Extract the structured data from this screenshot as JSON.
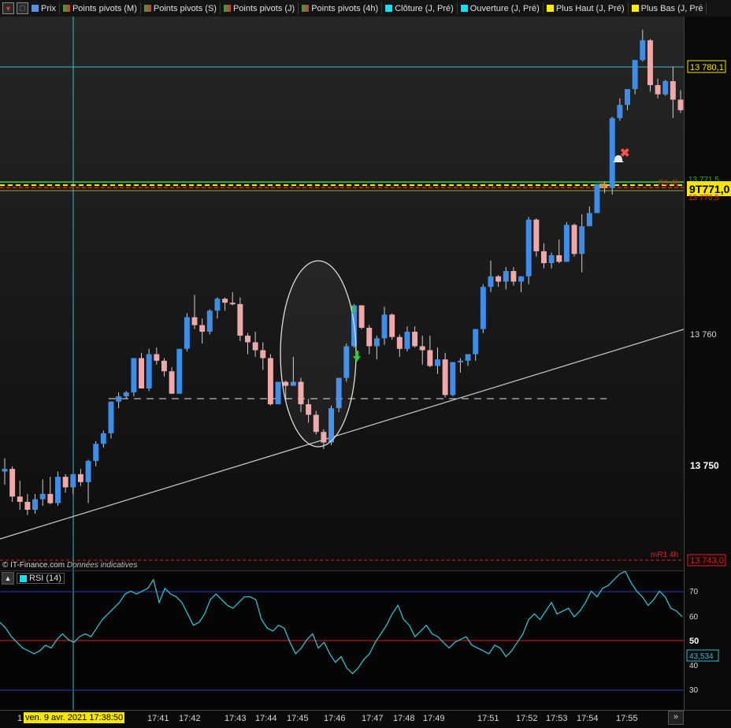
{
  "toolbar": {
    "items": [
      {
        "label": "Prix",
        "color": "#5c8ee6"
      },
      {
        "label": "Points pivots (M)",
        "color": "#2fa83a"
      },
      {
        "label": "Points pivots (S)",
        "color": "#2fa83a"
      },
      {
        "label": "Points pivots (J)",
        "color": "#2fa83a"
      },
      {
        "label": "Points pivots (4h)",
        "color": "#2fa83a"
      },
      {
        "label": "Clôture (J, Pré)",
        "color": "#00e5ff"
      },
      {
        "label": "Ouverture (J, Pré)",
        "color": "#00e5ff"
      },
      {
        "label": "Plus Haut (J, Pré)",
        "color": "#ffee00"
      },
      {
        "label": "Plus Bas (J, Pré",
        "color": "#ffee00"
      }
    ]
  },
  "watermark": {
    "source": "© IT-Finance.com",
    "note": "Données indicatives"
  },
  "rsi_title": "RSI (14)",
  "date_label": "ven. 9 avr. 2021 17:38:50",
  "x_first_char": "1",
  "scroll_glyph": "»",
  "price_labels": {
    "p1": "13 780,1",
    "p2": "13 771,5",
    "p3": "9T771,0",
    "p4": "13 770,5",
    "p5": "13 760",
    "p6": "13 750",
    "p7": "13 743,0",
    "r1": "R1 4h",
    "mr1": "mR1 4h"
  },
  "rsi_labels": {
    "t70": "70",
    "t60": "60",
    "t50": "50",
    "t40": "40",
    "t30": "30",
    "current": "43,534"
  },
  "x_labels": [
    "17:41",
    "17:42",
    "17:43",
    "17:44",
    "17:45",
    "17:46",
    "17:47",
    "17:48",
    "17:49",
    "17:51",
    "17:52",
    "17:53",
    "17:54",
    "17:55"
  ],
  "colors": {
    "up": "#3d8eea",
    "down": "#f0a8a8",
    "rsi": "#2fbfcf",
    "ref_line": "#3bbccc"
  },
  "chart_data": {
    "type": "candlestick",
    "ylim": [
      13742,
      13784
    ],
    "ohlc": [
      [
        13749.5,
        13750.5,
        13748.5,
        13749.7
      ],
      [
        13749.7,
        13749.9,
        13747.2,
        13747.6
      ],
      [
        13747.6,
        13748.8,
        13746.6,
        13747.2
      ],
      [
        13747.2,
        13747.8,
        13746.2,
        13746.6
      ],
      [
        13746.6,
        13747.8,
        13746.3,
        13747.4
      ],
      [
        13747.4,
        13748.9,
        13746.9,
        13747.8
      ],
      [
        13747.8,
        13749.1,
        13747.0,
        13747.1
      ],
      [
        13747.1,
        13749.5,
        13746.9,
        13749.1
      ],
      [
        13749.1,
        13749.3,
        13747.9,
        13748.3
      ],
      [
        13748.3,
        13749.3,
        13747.8,
        13749.3
      ],
      [
        13749.3,
        13749.7,
        13748.4,
        13748.7
      ],
      [
        13748.7,
        13750.4,
        13747.1,
        13750.3
      ],
      [
        13750.3,
        13751.8,
        13749.9,
        13751.6
      ],
      [
        13751.6,
        13752.6,
        13751.3,
        13752.4
      ],
      [
        13752.4,
        13754.8,
        13752.0,
        13754.8
      ],
      [
        13754.8,
        13755.5,
        13754.3,
        13755.2
      ],
      [
        13755.2,
        13755.6,
        13755.0,
        13755.5
      ],
      [
        13755.5,
        13758.1,
        13755.2,
        13758.1
      ],
      [
        13758.1,
        13758.5,
        13755.8,
        13755.8
      ],
      [
        13755.8,
        13758.8,
        13755.6,
        13758.4
      ],
      [
        13758.4,
        13758.9,
        13757.6,
        13757.9
      ],
      [
        13757.9,
        13758.1,
        13756.7,
        13757.1
      ],
      [
        13757.1,
        13757.4,
        13755.4,
        13755.4
      ],
      [
        13755.4,
        13758.8,
        13755.4,
        13758.8
      ],
      [
        13758.8,
        13761.5,
        13758.6,
        13761.2
      ],
      [
        13761.2,
        13762.9,
        13760.3,
        13760.6
      ],
      [
        13760.6,
        13761.1,
        13759.2,
        13760.1
      ],
      [
        13760.1,
        13761.8,
        13759.9,
        13761.7
      ],
      [
        13761.7,
        13762.7,
        13761.1,
        13762.6
      ],
      [
        13762.6,
        13762.7,
        13761.7,
        13762.3
      ],
      [
        13762.3,
        13763.1,
        13762.1,
        13762.2
      ],
      [
        13762.2,
        13762.7,
        13759.4,
        13759.8
      ],
      [
        13759.8,
        13760.0,
        13758.4,
        13759.3
      ],
      [
        13759.3,
        13760.1,
        13758.2,
        13758.7
      ],
      [
        13758.7,
        13759.3,
        13757.2,
        13758.1
      ],
      [
        13758.1,
        13758.4,
        13754.5,
        13754.6
      ],
      [
        13754.6,
        13756.3,
        13754.6,
        13756.3
      ],
      [
        13756.3,
        13756.4,
        13754.9,
        13756.0
      ],
      [
        13756.0,
        13758.2,
        13756.1,
        13756.3
      ],
      [
        13756.3,
        13756.6,
        13754.0,
        13754.6
      ],
      [
        13754.6,
        13755.0,
        13753.2,
        13753.8
      ],
      [
        13753.8,
        13754.1,
        13752.3,
        13752.5
      ],
      [
        13752.5,
        13752.7,
        13751.2,
        13751.7
      ],
      [
        13751.7,
        13754.5,
        13751.5,
        13754.3
      ],
      [
        13754.3,
        13756.6,
        13754.0,
        13756.6
      ],
      [
        13756.6,
        13759.2,
        13756.3,
        13759.0
      ],
      [
        13759.0,
        13762.2,
        13758.9,
        13762.1
      ],
      [
        13762.1,
        13762.1,
        13760.3,
        13760.4
      ],
      [
        13760.4,
        13760.6,
        13758.4,
        13759.0
      ],
      [
        13759.0,
        13759.8,
        13758.0,
        13759.6
      ],
      [
        13759.6,
        13762.0,
        13759.1,
        13761.4
      ],
      [
        13761.4,
        13761.5,
        13759.5,
        13759.7
      ],
      [
        13759.7,
        13759.9,
        13758.2,
        13758.8
      ],
      [
        13758.8,
        13760.5,
        13758.6,
        13760.1
      ],
      [
        13760.1,
        13760.5,
        13758.9,
        13759.0
      ],
      [
        13759.0,
        13759.8,
        13757.6,
        13758.7
      ],
      [
        13758.7,
        13759.8,
        13757.4,
        13757.5
      ],
      [
        13757.5,
        13758.9,
        13756.9,
        13758.0
      ],
      [
        13758.0,
        13758.5,
        13755.1,
        13755.3
      ],
      [
        13755.3,
        13757.8,
        13755.2,
        13757.8
      ],
      [
        13757.8,
        13758.1,
        13757.0,
        13757.9
      ],
      [
        13757.9,
        13758.4,
        13757.5,
        13758.4
      ],
      [
        13758.4,
        13760.3,
        13757.9,
        13760.3
      ],
      [
        13760.3,
        13763.7,
        13760.0,
        13763.5
      ],
      [
        13763.5,
        13765.5,
        13763.1,
        13764.3
      ],
      [
        13764.3,
        13764.4,
        13763.5,
        13763.9
      ],
      [
        13763.9,
        13765.0,
        13763.3,
        13764.7
      ],
      [
        13764.7,
        13765.0,
        13763.6,
        13763.9
      ],
      [
        13763.9,
        13764.3,
        13763.1,
        13764.3
      ],
      [
        13764.3,
        13768.8,
        13763.7,
        13768.6
      ],
      [
        13768.6,
        13768.7,
        13765.8,
        13766.2
      ],
      [
        13766.2,
        13766.8,
        13764.9,
        13765.3
      ],
      [
        13765.3,
        13766.1,
        13764.9,
        13765.9
      ],
      [
        13765.9,
        13767.1,
        13765.3,
        13765.4
      ],
      [
        13765.4,
        13768.4,
        13765.4,
        13768.2
      ],
      [
        13768.2,
        13768.3,
        13765.8,
        13766.0
      ],
      [
        13766.0,
        13769.0,
        13764.6,
        13768.1
      ],
      [
        13768.1,
        13769.6,
        13768.1,
        13769.1
      ],
      [
        13769.1,
        13771.3,
        13769.1,
        13771.3
      ],
      [
        13771.3,
        13771.5,
        13770.6,
        13771.0
      ],
      [
        13771.0,
        13776.4,
        13770.5,
        13776.3
      ],
      [
        13776.3,
        13777.8,
        13776.1,
        13777.3
      ],
      [
        13777.3,
        13778.3,
        13776.9,
        13778.5
      ],
      [
        13778.5,
        13780.7,
        13778.1,
        13780.7
      ],
      [
        13780.7,
        13783.0,
        13780.6,
        13782.2
      ],
      [
        13782.2,
        13782.3,
        13778.3,
        13778.8
      ],
      [
        13778.8,
        13779.3,
        13777.8,
        13778.1
      ],
      [
        13778.1,
        13779.2,
        13778.0,
        13779.1
      ],
      [
        13779.1,
        13780.2,
        13776.3,
        13777.7
      ],
      [
        13777.7,
        13778.4,
        13776.7,
        13776.9
      ]
    ],
    "rsi": [
      59,
      57,
      54,
      52,
      50,
      49,
      48,
      49,
      51,
      50,
      53,
      55,
      53,
      52,
      54,
      55,
      54,
      57,
      60,
      62,
      64,
      66,
      69,
      70,
      69,
      70,
      71,
      74,
      66,
      71,
      69,
      68,
      66,
      62,
      58,
      59,
      62,
      67,
      69,
      67,
      65,
      64,
      66,
      68,
      68,
      67,
      60,
      57,
      56,
      58,
      57,
      52,
      48,
      50,
      53,
      55,
      50,
      52,
      48,
      45,
      47,
      43,
      41,
      43,
      46,
      48,
      52,
      55,
      58,
      62,
      65,
      60,
      58,
      54,
      56,
      58,
      55,
      54,
      52,
      50,
      52,
      53,
      54,
      51,
      50,
      49,
      48,
      51,
      50,
      47,
      49,
      52,
      55,
      60,
      62,
      60,
      63,
      66,
      62,
      63,
      64,
      61,
      63,
      66,
      70,
      68,
      71,
      72,
      74,
      76,
      77,
      73,
      70,
      68,
      65,
      67,
      70,
      68,
      64,
      63,
      61
    ],
    "rsi_ylim": [
      28,
      77
    ],
    "rsi_levels": [
      70,
      50,
      30
    ],
    "yticks": [
      "13 760",
      "13 750"
    ],
    "xticks": [
      "17:41",
      "17:42",
      "17:43",
      "17:44",
      "17:45",
      "17:46",
      "17:47",
      "17:48",
      "17:49",
      "17:51",
      "17:52",
      "17:53",
      "17:54",
      "17:55"
    ]
  }
}
